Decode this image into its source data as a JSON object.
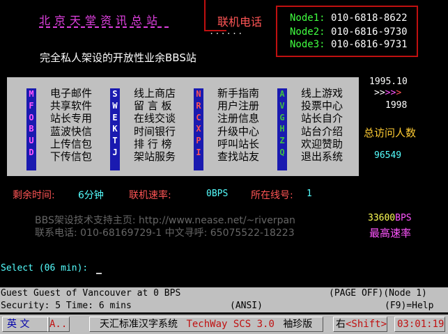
{
  "header": {
    "title": "北京天堂资讯总站",
    "phone_label": "联机电话",
    "dots": "......",
    "nodes": [
      {
        "label": "Node1:",
        "number": "010-6818-8622"
      },
      {
        "label": "Node2:",
        "number": "010-6816-9730"
      },
      {
        "label": "Node3:",
        "number": "010-6816-9731"
      }
    ]
  },
  "tagline": "完全私人架设的开放性业余BBS站",
  "menu_columns": [
    {
      "letters": [
        "M",
        "F",
        "O",
        "B",
        "U",
        "D"
      ],
      "letter_color": "#ff55ff",
      "items": [
        "电子邮件",
        "共享软件",
        "站长专用",
        "蓝波快信",
        "上传信包",
        "下传信包"
      ]
    },
    {
      "letters": [
        "S",
        "W",
        "E",
        "K",
        "T",
        "J"
      ],
      "letter_color": "#ffffff",
      "items": [
        "线上商店",
        "留 言 板",
        "在线交谈",
        "时间银行",
        "排 行 榜",
        "架站服务"
      ]
    },
    {
      "letters": [
        "N",
        "R",
        "C",
        "X",
        "P",
        "I"
      ],
      "letter_color": "#ff5555",
      "items": [
        "新手指南",
        "用户注册",
        "注册信息",
        "升级中心",
        "呼叫站长",
        "查找站友"
      ]
    },
    {
      "letters": [
        "A",
        "V",
        "G",
        "H",
        "Z",
        "Q"
      ],
      "letter_color": "#40c040",
      "items": [
        "线上游戏",
        "投票中心",
        "站长自介",
        "站台介绍",
        "欢迎赞助",
        "退出系统"
      ]
    }
  ],
  "right_panel": {
    "version": "1995.10",
    "arrows": ">>>>>",
    "year": "1998",
    "visits_label": "总访问人数",
    "visits": "96549"
  },
  "status": {
    "remaining_label": "剩余时间:",
    "remaining_value": "6分钟",
    "speed_label": "联机速率:",
    "speed_value": "0BPS",
    "line_label": "所在线号:",
    "line_value": "1"
  },
  "support": {
    "line1": "BBS架设技术支持主页: http://www.nease.net/~riverpan",
    "line2": "联系电话: 010-68169729-1   中文寻呼: 65075522-18223"
  },
  "max_speed": {
    "value": "33600",
    "unit": "BPS",
    "label": "最高速率"
  },
  "prompt": "Select (06 min): ",
  "bar1": {
    "left": "Guest Guest of Vancouver at 0 BPS",
    "right": "(PAGE OFF)(Node 1)"
  },
  "bar2": {
    "left": "Security: 5  Time: 6 mins",
    "mid": "(ANSI)",
    "right": "(F9)=Help"
  },
  "ime": {
    "mode": "英 文",
    "half": "A..",
    "system": "天汇标准汉字系统",
    "brand": "TechWay SCS 3.0",
    "edition": "袖珍版",
    "shift_label": "右",
    "shift_key": "<Shift>",
    "clock": "03:01:19"
  }
}
